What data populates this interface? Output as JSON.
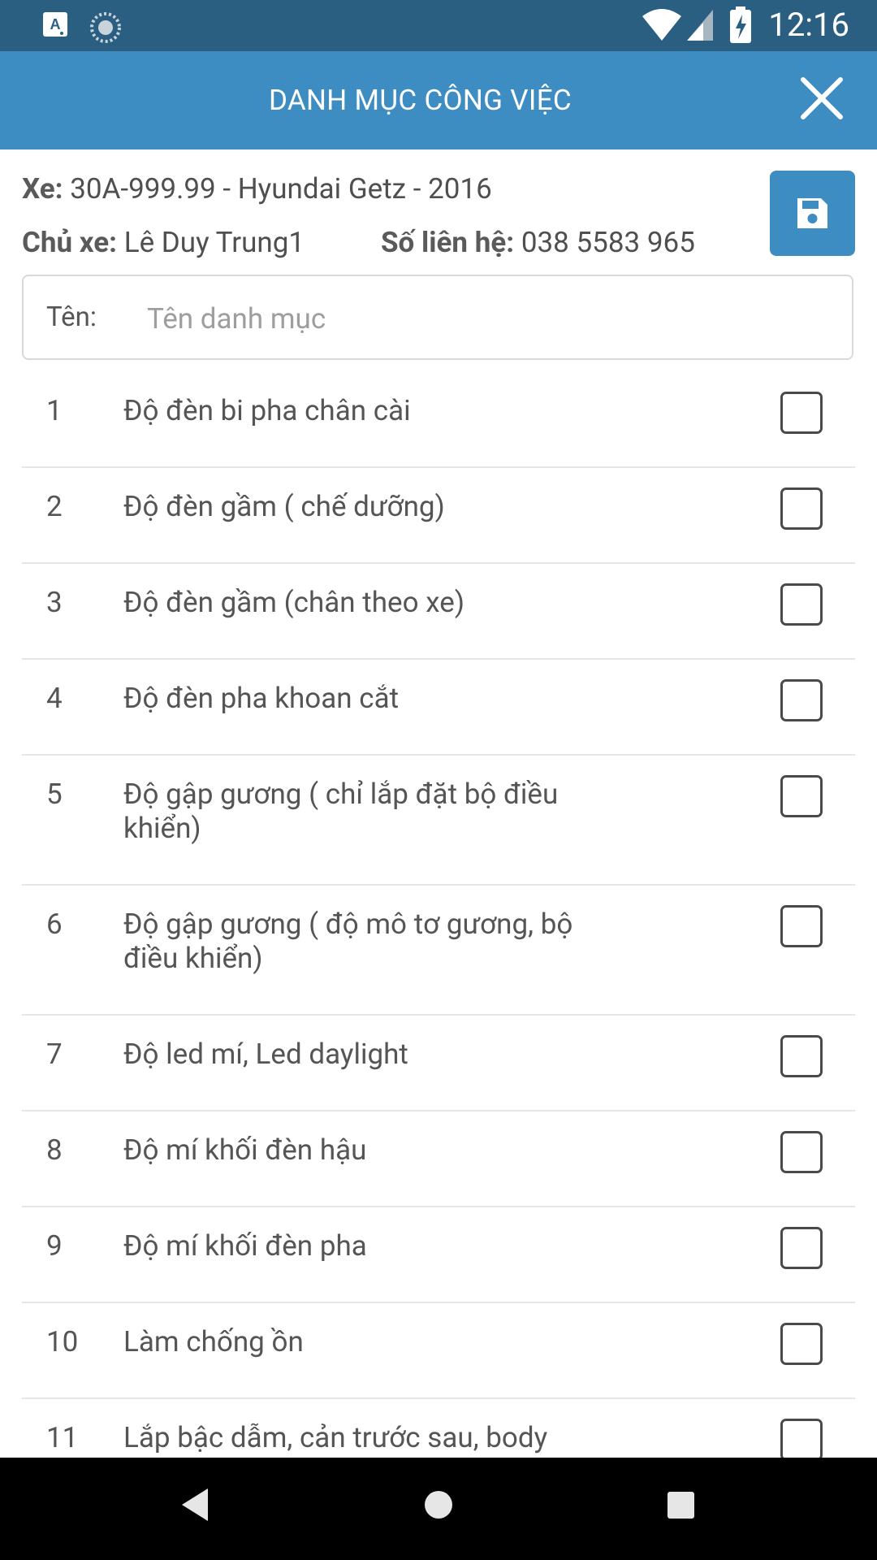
{
  "status_bar": {
    "time": "12:16",
    "icons": [
      "app-a-icon",
      "sync-icon",
      "wifi-icon",
      "signal-icon",
      "battery-charging-icon"
    ]
  },
  "app_bar": {
    "title": "DANH MỤC CÔNG VIỆC",
    "close_icon": "close-icon"
  },
  "info": {
    "vehicle_label": "Xe:",
    "vehicle_value": "30A-999.99 - Hyundai Getz - 2016",
    "owner_label": "Chủ xe:",
    "owner_value": "Lê Duy Trung1",
    "contact_label": "Số liên hệ:",
    "contact_value": "038 5583 965"
  },
  "save_button": {
    "icon": "save-icon"
  },
  "search": {
    "label": "Tên:",
    "placeholder": "Tên danh mục",
    "value": ""
  },
  "items": [
    {
      "num": "1",
      "name": "Độ đèn bi pha chân cài",
      "checked": false
    },
    {
      "num": "2",
      "name": "Độ đèn gầm ( chế dưỡng)",
      "checked": false
    },
    {
      "num": "3",
      "name": "Độ đèn gầm (chân theo xe)",
      "checked": false
    },
    {
      "num": "4",
      "name": "Độ đèn pha khoan cắt",
      "checked": false
    },
    {
      "num": "5",
      "name": "Độ gập gương ( chỉ lắp đặt bộ điều khiển)",
      "checked": false
    },
    {
      "num": "6",
      "name": "Độ gập gương ( độ mô tơ gương, bộ điều khiển)",
      "checked": false
    },
    {
      "num": "7",
      "name": "Độ led mí, Led daylight",
      "checked": false
    },
    {
      "num": "8",
      "name": "Độ mí khối đèn hậu",
      "checked": false
    },
    {
      "num": "9",
      "name": "Độ mí khối đèn pha",
      "checked": false
    },
    {
      "num": "10",
      "name": "Làm chống ồn",
      "checked": false
    },
    {
      "num": "11",
      "name": "Lắp bậc dẫm, cản trước sau, body",
      "checked": false
    }
  ],
  "nav_bar": {
    "icons": [
      "back-icon",
      "home-icon",
      "recents-icon"
    ]
  },
  "colors": {
    "status_bar": "#2b5f82",
    "app_bar": "#3d8cc2",
    "accent": "#3d8cc2"
  }
}
